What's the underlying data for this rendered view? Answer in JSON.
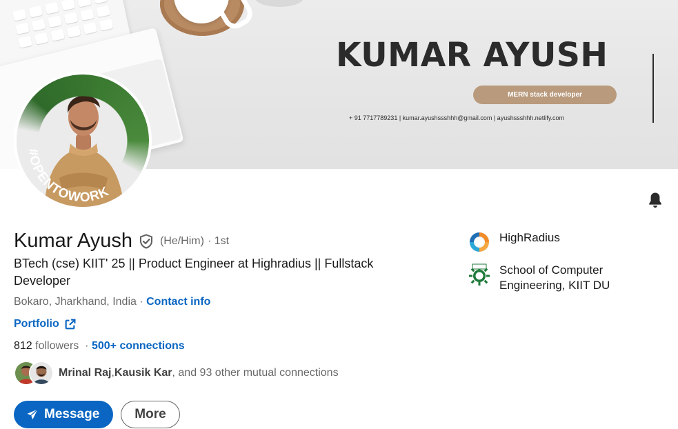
{
  "banner": {
    "name": "KUMAR AYUSH",
    "role_pill": "MERN stack developer",
    "contact_line": "+ 91 7717789231  |  kumar.ayushssshhh@gmail.com  |  ayushssshhh.netlify.com"
  },
  "avatar": {
    "badge_text": "#OPENTOWORK",
    "badge_color": "#3b7a31"
  },
  "profile": {
    "name": "Kumar Ayush",
    "pronouns": "(He/Him)",
    "degree": "· 1st",
    "headline": "BTech (cse) KIIT' 25 || Product Engineer at Highradius || Fullstack Developer",
    "location": "Bokaro, Jharkhand, India",
    "location_sep": " · ",
    "contact_info_label": "Contact info",
    "portfolio_label": "Portfolio",
    "followers_count": "812",
    "followers_label": " followers",
    "connections_sep": "  · ",
    "connections_label": "500+ connections",
    "mutual": {
      "name1": "Mrinal Raj",
      "sep1": ", ",
      "name2": "Kausik Kar",
      "rest": ", and 93 other mutual connections"
    }
  },
  "actions": {
    "message_label": "Message",
    "more_label": "More"
  },
  "orgs": [
    {
      "label": "HighRadius",
      "icon": "highradius-logo-icon"
    },
    {
      "label": "School of Computer Engineering, KIIT DU",
      "icon": "kiit-logo-icon"
    }
  ],
  "icons": {
    "notification": "bell-icon",
    "verification": "shield-check-icon",
    "external_link": "external-link-icon",
    "send": "paper-plane-icon"
  },
  "colors": {
    "link": "#0a66c2",
    "primary_button": "#0a66c2",
    "open_to_work": "#3b7a31",
    "banner_pill": "#b99a7d"
  }
}
